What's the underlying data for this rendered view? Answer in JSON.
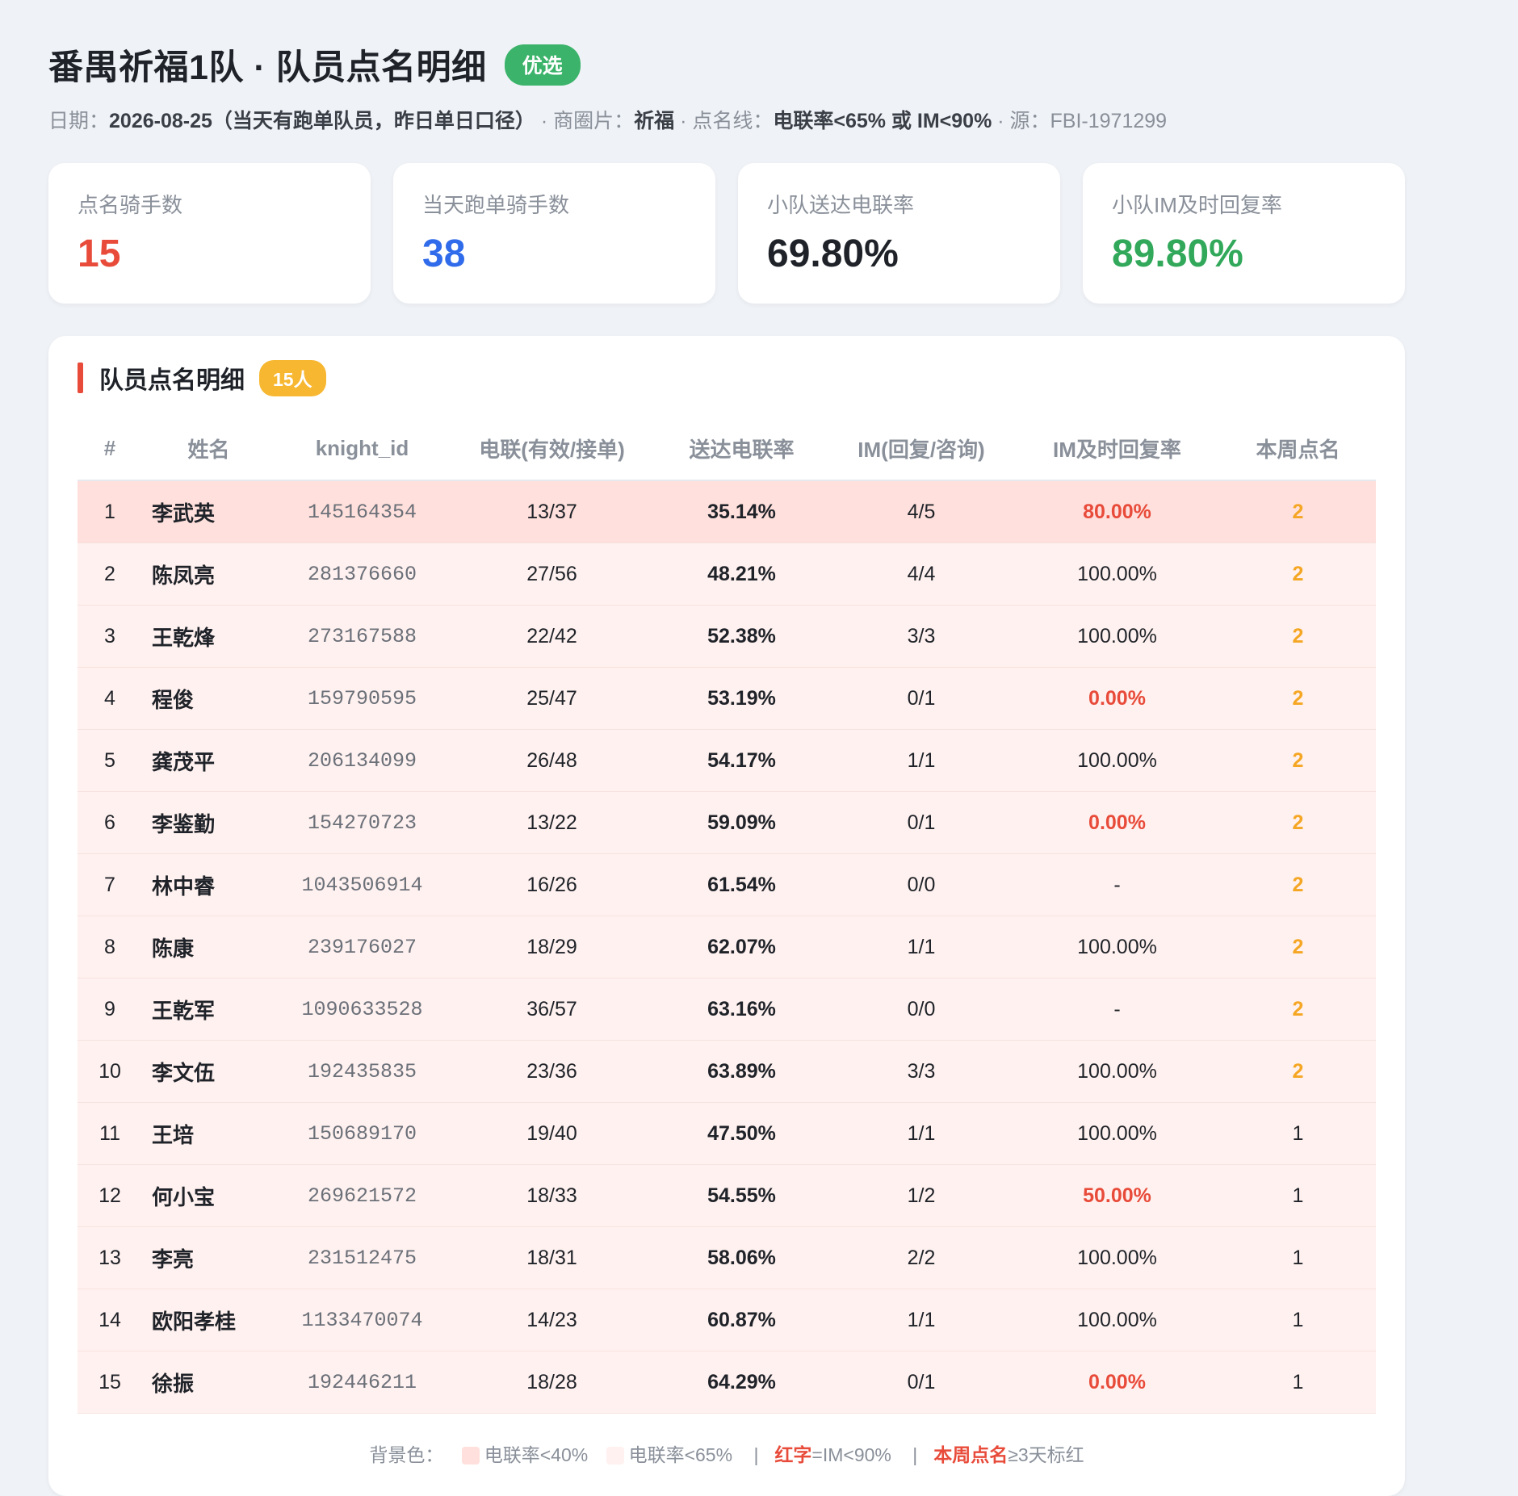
{
  "header": {
    "title": "番禺祈福1队 · 队员点名明细",
    "badge": "优选",
    "subtitle": {
      "date_label": "日期：",
      "date_value": "2026-08-25（当天有跑单队员，昨日单日口径）",
      "sep1": " · 商圈片：",
      "area_value": "祈福",
      "sep2": " · 点名线：",
      "line_value": "电联率<65% 或 IM<90%",
      "sep3": " · 源：FBI-1971299"
    }
  },
  "kpis": [
    {
      "label": "点名骑手数",
      "value": "15",
      "color": "#e84b3a"
    },
    {
      "label": "当天跑单骑手数",
      "value": "38",
      "color": "#2f6bea"
    },
    {
      "label": "小队送达电联率",
      "value": "69.80%",
      "color": "#1f2329"
    },
    {
      "label": "小队IM及时回复率",
      "value": "89.80%",
      "color": "#31a85a"
    }
  ],
  "section": {
    "title": "队员点名明细",
    "count": "15人"
  },
  "table": {
    "headers": [
      "#",
      "姓名",
      "knight_id",
      "电联(有效/接单)",
      "送达电联率",
      "IM(回复/咨询)",
      "IM及时回复率",
      "本周点名"
    ],
    "rows": [
      {
        "no": "1",
        "name": "李武英",
        "id": "145164354",
        "call": "13/37",
        "rate": "35.14%",
        "im": "4/5",
        "im_rate": "80.00%",
        "week": "2",
        "low": true,
        "im_red": true,
        "week_hl": true
      },
      {
        "no": "2",
        "name": "陈凤亮",
        "id": "281376660",
        "call": "27/56",
        "rate": "48.21%",
        "im": "4/4",
        "im_rate": "100.00%",
        "week": "2",
        "low": false,
        "im_red": false,
        "week_hl": true
      },
      {
        "no": "3",
        "name": "王乾烽",
        "id": "273167588",
        "call": "22/42",
        "rate": "52.38%",
        "im": "3/3",
        "im_rate": "100.00%",
        "week": "2",
        "low": false,
        "im_red": false,
        "week_hl": true
      },
      {
        "no": "4",
        "name": "程俊",
        "id": "159790595",
        "call": "25/47",
        "rate": "53.19%",
        "im": "0/1",
        "im_rate": "0.00%",
        "week": "2",
        "low": false,
        "im_red": true,
        "week_hl": true
      },
      {
        "no": "5",
        "name": "龚茂平",
        "id": "206134099",
        "call": "26/48",
        "rate": "54.17%",
        "im": "1/1",
        "im_rate": "100.00%",
        "week": "2",
        "low": false,
        "im_red": false,
        "week_hl": true
      },
      {
        "no": "6",
        "name": "李鉴勤",
        "id": "154270723",
        "call": "13/22",
        "rate": "59.09%",
        "im": "0/1",
        "im_rate": "0.00%",
        "week": "2",
        "low": false,
        "im_red": true,
        "week_hl": true
      },
      {
        "no": "7",
        "name": "林中睿",
        "id": "1043506914",
        "call": "16/26",
        "rate": "61.54%",
        "im": "0/0",
        "im_rate": "-",
        "week": "2",
        "low": false,
        "im_red": false,
        "week_hl": true
      },
      {
        "no": "8",
        "name": "陈康",
        "id": "239176027",
        "call": "18/29",
        "rate": "62.07%",
        "im": "1/1",
        "im_rate": "100.00%",
        "week": "2",
        "low": false,
        "im_red": false,
        "week_hl": true
      },
      {
        "no": "9",
        "name": "王乾军",
        "id": "1090633528",
        "call": "36/57",
        "rate": "63.16%",
        "im": "0/0",
        "im_rate": "-",
        "week": "2",
        "low": false,
        "im_red": false,
        "week_hl": true
      },
      {
        "no": "10",
        "name": "李文伍",
        "id": "192435835",
        "call": "23/36",
        "rate": "63.89%",
        "im": "3/3",
        "im_rate": "100.00%",
        "week": "2",
        "low": false,
        "im_red": false,
        "week_hl": true
      },
      {
        "no": "11",
        "name": "王培",
        "id": "150689170",
        "call": "19/40",
        "rate": "47.50%",
        "im": "1/1",
        "im_rate": "100.00%",
        "week": "1",
        "low": false,
        "im_red": false,
        "week_hl": false
      },
      {
        "no": "12",
        "name": "何小宝",
        "id": "269621572",
        "call": "18/33",
        "rate": "54.55%",
        "im": "1/2",
        "im_rate": "50.00%",
        "week": "1",
        "low": false,
        "im_red": true,
        "week_hl": false
      },
      {
        "no": "13",
        "name": "李亮",
        "id": "231512475",
        "call": "18/31",
        "rate": "58.06%",
        "im": "2/2",
        "im_rate": "100.00%",
        "week": "1",
        "low": false,
        "im_red": false,
        "week_hl": false
      },
      {
        "no": "14",
        "name": "欧阳孝桂",
        "id": "1133470074",
        "call": "14/23",
        "rate": "60.87%",
        "im": "1/1",
        "im_rate": "100.00%",
        "week": "1",
        "low": false,
        "im_red": false,
        "week_hl": false
      },
      {
        "no": "15",
        "name": "徐振",
        "id": "192446211",
        "call": "18/28",
        "rate": "64.29%",
        "im": "0/1",
        "im_rate": "0.00%",
        "week": "1",
        "low": false,
        "im_red": true,
        "week_hl": false
      }
    ]
  },
  "legend": {
    "prefix": "背景色：",
    "low_label": "电联率<40%",
    "low_color": "#ffe0dc",
    "mid_label": "电联率<65%",
    "mid_color": "#fff1ef",
    "sep": "|",
    "red_word": "红字",
    "red_rest": "=IM<90%",
    "week_word": "本周点名",
    "week_rest": "≥3天标红"
  }
}
